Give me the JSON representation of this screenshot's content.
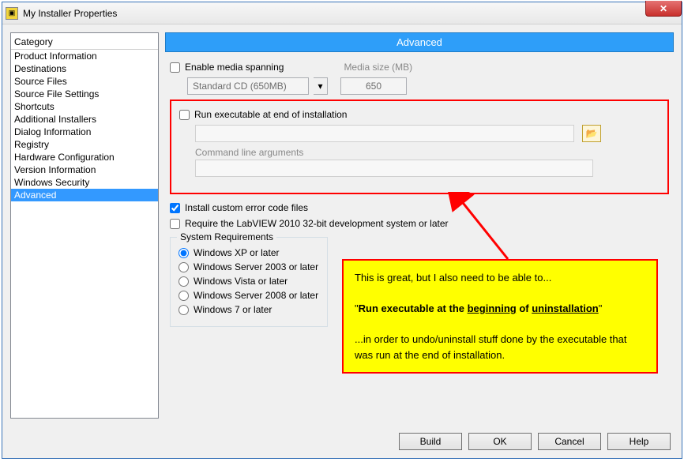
{
  "window": {
    "title": "My Installer Properties"
  },
  "sidebar": {
    "header": "Category",
    "items": [
      "Product Information",
      "Destinations",
      "Source Files",
      "Source File Settings",
      "Shortcuts",
      "Additional Installers",
      "Dialog Information",
      "Registry",
      "Hardware Configuration",
      "Version Information",
      "Windows Security",
      "Advanced"
    ],
    "selected": "Advanced"
  },
  "main": {
    "header": "Advanced",
    "enable_media_spanning": "Enable media spanning",
    "media_size_label": "Media size (MB)",
    "media_combo": "Standard CD (650MB)",
    "media_value": "650",
    "run_exe_label": "Run executable at end of installation",
    "args_label": "Command line arguments",
    "install_error_codes": "Install custom error code files",
    "require_labview": "Require the LabVIEW 2010 32-bit development system or later",
    "sysreq_legend": "System Requirements",
    "sysreq_options": [
      "Windows XP or later",
      "Windows Server 2003 or later",
      "Windows Vista or later",
      "Windows Server 2008 or later",
      "Windows 7 or later"
    ]
  },
  "buttons": {
    "build": "Build",
    "ok": "OK",
    "cancel": "Cancel",
    "help": "Help"
  },
  "annotation": {
    "line1": "This is great, but I also need to be able to...",
    "quote_prefix": "\"",
    "quote_a": "Run executable at the ",
    "quote_b": "beginning",
    "quote_c": " of ",
    "quote_d": "uninstallation",
    "quote_suffix": "\"",
    "line3": "...in order to undo/uninstall stuff done by the executable that was run at the end of installation."
  }
}
